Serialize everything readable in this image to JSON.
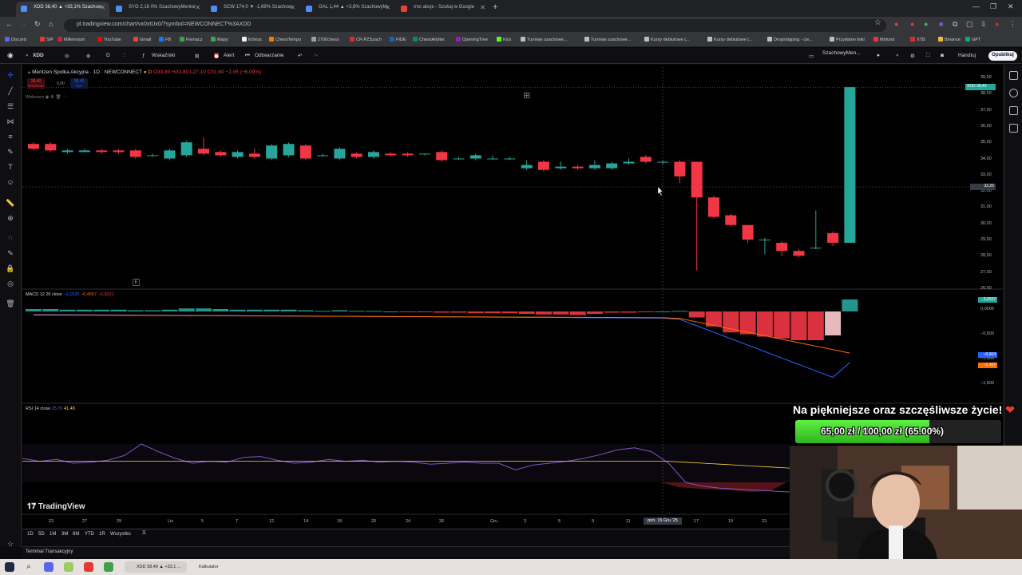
{
  "browser": {
    "tabs": [
      {
        "label": "XDD 38,40 ▲ +33,1% Szachow",
        "color": "#4f8ef7",
        "active": true
      },
      {
        "label": "SYG 2,16 0% SzachowyMentor",
        "color": "#4f8ef7",
        "active": false
      },
      {
        "label": "SCW 174,0 ▼ -1,69% Szachow",
        "color": "#4f8ef7",
        "active": false
      },
      {
        "label": "GAL 1,44 ▲ +3,6% SzachowyM",
        "color": "#4f8ef7",
        "active": false
      },
      {
        "label": "rmc akcje - Szukaj w Google",
        "color": "#ea4335",
        "active": false
      }
    ],
    "url": "pl.tradingview.com/chart/vx0xtUx0/?symbol=NEWCONNECT%3AXDD",
    "bookmarks": [
      "Discord",
      "SIP",
      "Millennium",
      "YouTube",
      "Gmail",
      "FB",
      "Fixmacz",
      "Mapy",
      "lichess",
      "ChessTempo",
      "2700chess",
      "CR PZSzach",
      "FIDE",
      "ChessArbiter",
      "OpeningTree",
      "Kick",
      "Turnieje szachowe...",
      "Turnieje szachowe...",
      "Kursy debiutowe (...",
      "Kursy debiutowe (...",
      "Dropshipping - cie...",
      "Przydatne linki",
      "Myfund",
      "XTB",
      "Binance",
      "GPT"
    ]
  },
  "toolbar": {
    "symbol": "XDD",
    "interval": "D",
    "indicators": "Wskaźniki",
    "alert": "Alert",
    "replay": "Odtwarzanie",
    "layout_name": "SzachowyMen...",
    "trade": "Handluj",
    "publish": "Opublikuj"
  },
  "legend": {
    "title": "Mentzen Spolka Akcyjna · 1D · NEWCONNECT",
    "ohlc": "O33,80 H33,80 L27,10 C31,60 −2,05 (−6,09%)",
    "sell_price": "38,40",
    "sell_label": "SPRZEDAJ",
    "spread": "0,00",
    "buy_price": "38,40",
    "buy_label": "KUP",
    "volume_label": "Wolumen"
  },
  "price_axis": [
    "39,00",
    "38,00",
    "37,00",
    "36,00",
    "35,00",
    "34,00",
    "33,00",
    "32,00",
    "31,00",
    "30,00",
    "29,00",
    "28,00",
    "27,00",
    "26,00"
  ],
  "price_tags": {
    "last": "38,40",
    "last_symbol": "XDD",
    "crosshair": "32,25"
  },
  "x_axis": [
    "23",
    "27",
    "29",
    "Lis",
    "5",
    "7",
    "12",
    "14",
    "18",
    "20",
    "24",
    "26",
    "Gru",
    "3",
    "5",
    "9",
    "11",
    "17",
    "19",
    "23"
  ],
  "crosshair_date": "pon. 15 Gru '25",
  "macd": {
    "legend_name": "MACD 12 26 close",
    "values": [
      "−0,1535",
      "−0,4557",
      "−0,3021"
    ],
    "axis": [
      "0,0000",
      "−0,500",
      "−1,000",
      "−1,500"
    ],
    "tags": [
      "0,2037",
      "−0,904",
      "−1,107"
    ]
  },
  "rsi": {
    "legend_name": "RSI 14 close",
    "values": [
      "25,70",
      "41,48"
    ]
  },
  "chart_data": {
    "type": "candlestick",
    "title": "Mentzen Spolka Akcyjna · 1D · NEWCONNECT",
    "ylim": [
      26,
      39.5
    ],
    "up_color": "#26a69a",
    "down_color": "#f23645",
    "candles": [
      {
        "o": 34.9,
        "c": 34.6,
        "h": 35.0,
        "l": 34.5
      },
      {
        "o": 34.9,
        "c": 34.5,
        "h": 35.0,
        "l": 34.4
      },
      {
        "o": 34.4,
        "c": 34.5,
        "h": 34.6,
        "l": 34.3
      },
      {
        "o": 34.4,
        "c": 34.5,
        "h": 34.6,
        "l": 34.4
      },
      {
        "o": 34.5,
        "c": 34.4,
        "h": 34.6,
        "l": 34.3
      },
      {
        "o": 34.5,
        "c": 34.4,
        "h": 34.6,
        "l": 34.3
      },
      {
        "o": 34.5,
        "c": 34.1,
        "h": 34.6,
        "l": 34.0
      },
      {
        "o": 34.2,
        "c": 34.2,
        "h": 34.3,
        "l": 34.1
      },
      {
        "o": 34.0,
        "c": 34.5,
        "h": 34.6,
        "l": 33.9
      },
      {
        "o": 34.2,
        "c": 35.0,
        "h": 35.1,
        "l": 34.1
      },
      {
        "o": 34.6,
        "c": 34.3,
        "h": 35.3,
        "l": 34.2
      },
      {
        "o": 34.4,
        "c": 34.2,
        "h": 34.5,
        "l": 34.1
      },
      {
        "o": 34.1,
        "c": 34.4,
        "h": 34.5,
        "l": 34.0
      },
      {
        "o": 34.3,
        "c": 34.1,
        "h": 34.6,
        "l": 34.0
      },
      {
        "o": 34.0,
        "c": 34.8,
        "h": 34.9,
        "l": 33.9
      },
      {
        "o": 34.2,
        "c": 34.9,
        "h": 35.0,
        "l": 34.1
      },
      {
        "o": 34.8,
        "c": 34.0,
        "h": 34.9,
        "l": 33.9
      },
      {
        "o": 34.2,
        "c": 34.2,
        "h": 34.3,
        "l": 34.1
      },
      {
        "o": 34.0,
        "c": 34.6,
        "h": 34.7,
        "l": 33.9
      },
      {
        "o": 34.3,
        "c": 34.1,
        "h": 34.4,
        "l": 34.0
      },
      {
        "o": 34.1,
        "c": 34.4,
        "h": 34.5,
        "l": 34.0
      },
      {
        "o": 34.3,
        "c": 34.2,
        "h": 34.4,
        "l": 34.1
      },
      {
        "o": 34.3,
        "c": 34.2,
        "h": 34.4,
        "l": 34.1
      },
      {
        "o": 34.3,
        "c": 34.3,
        "h": 34.3,
        "l": 34.2
      },
      {
        "o": 34.4,
        "c": 33.9,
        "h": 34.5,
        "l": 33.8
      },
      {
        "o": 34.0,
        "c": 34.0,
        "h": 34.1,
        "l": 33.9
      },
      {
        "o": 34.0,
        "c": 34.2,
        "h": 34.3,
        "l": 33.9
      },
      {
        "o": 34.0,
        "c": 34.0,
        "h": 34.2,
        "l": 33.9
      },
      {
        "o": 34.0,
        "c": 34.0,
        "h": 34.1,
        "l": 33.9
      },
      {
        "o": 33.4,
        "c": 33.6,
        "h": 33.9,
        "l": 33.3
      },
      {
        "o": 33.8,
        "c": 33.3,
        "h": 33.9,
        "l": 33.2
      },
      {
        "o": 33.4,
        "c": 33.5,
        "h": 33.8,
        "l": 33.3
      },
      {
        "o": 33.5,
        "c": 33.4,
        "h": 33.6,
        "l": 33.3
      },
      {
        "o": 33.4,
        "c": 33.6,
        "h": 33.9,
        "l": 33.3
      },
      {
        "o": 33.4,
        "c": 33.7,
        "h": 33.8,
        "l": 33.3
      },
      {
        "o": 33.7,
        "c": 33.8,
        "h": 34.0,
        "l": 33.6
      },
      {
        "o": 34.1,
        "c": 33.8,
        "h": 34.2,
        "l": 33.7
      },
      {
        "o": 33.8,
        "c": 33.8,
        "h": 33.9,
        "l": 33.6
      },
      {
        "o": 33.8,
        "c": 32.9,
        "h": 33.9,
        "l": 32.5
      },
      {
        "o": 33.8,
        "c": 31.6,
        "h": 33.8,
        "l": 27.1
      },
      {
        "o": 31.6,
        "c": 30.4,
        "h": 31.7,
        "l": 30.3
      },
      {
        "o": 30.5,
        "c": 29.9,
        "h": 30.6,
        "l": 29.8
      },
      {
        "o": 29.9,
        "c": 29.0,
        "h": 29.9,
        "l": 28.8
      },
      {
        "o": 29.0,
        "c": 29.0,
        "h": 29.1,
        "l": 28.1
      },
      {
        "o": 28.8,
        "c": 28.3,
        "h": 28.9,
        "l": 28.0
      },
      {
        "o": 28.3,
        "c": 28.0,
        "h": 28.4,
        "l": 27.9
      },
      {
        "o": 28.5,
        "c": 28.5,
        "h": 30.8,
        "l": 28.4
      },
      {
        "o": 29.4,
        "c": 28.8,
        "h": 29.5,
        "l": 28.6
      },
      {
        "o": 28.8,
        "c": 38.4,
        "h": 38.4,
        "l": 28.8
      }
    ],
    "macd_hist": [
      0.04,
      0.04,
      0.03,
      0.03,
      0.03,
      0.03,
      0.02,
      0.02,
      0.03,
      0.05,
      0.05,
      0.04,
      0.03,
      0.03,
      0.03,
      0.03,
      0.02,
      0.01,
      0.02,
      0.01,
      0.01,
      0.0,
      -0.01,
      -0.01,
      -0.02,
      -0.02,
      -0.03,
      -0.03,
      -0.03,
      -0.04,
      -0.05,
      -0.05,
      -0.06,
      -0.04,
      -0.02,
      -0.02,
      -0.01,
      0.0,
      0.01,
      -0.1,
      -0.25,
      -0.35,
      -0.38,
      -0.42,
      -0.45,
      -0.48,
      -0.48,
      -0.4,
      0.2
    ],
    "rsi_ylim": [
      0,
      100
    ]
  },
  "overlay": {
    "title": "Na piękniejsze oraz szczęśliwsze życie!",
    "donation": "65,00 zł / 100,00 zł (65.00%)",
    "donation_fraction": 0.65
  },
  "bottom": {
    "timeframes": [
      "1D",
      "5D",
      "1M",
      "3M",
      "6M",
      "YTD",
      "1R",
      "Wszystko"
    ],
    "terminal": "Terminal Transakcyjny",
    "tv_logo": "TradingView"
  },
  "taskbar": {
    "tasks": [
      "XDD 38,40 ▲ +33,1 ...",
      "Kalkulator"
    ]
  }
}
